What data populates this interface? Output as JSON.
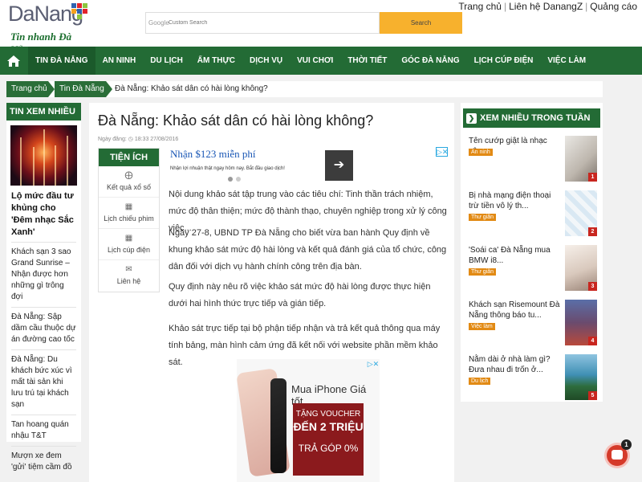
{
  "header": {
    "logo_text": "DaNang",
    "tagline": "Tin nhanh Đà Nẵng",
    "search_brand": "Google",
    "search_placeholder": "Custom Search",
    "search_button": "Search",
    "top_links": [
      "Trang chủ",
      "Liên hệ DanangZ",
      "Quảng cáo"
    ]
  },
  "nav": {
    "items": [
      "Tin Đà Nẵng",
      "An ninh",
      "Du lịch",
      "Ẩm thực",
      "Dịch vụ",
      "Vui chơi",
      "Thời tiết",
      "Góc Đà Nẵng",
      "Lịch cúp điện",
      "Việc làm"
    ]
  },
  "breadcrumb": {
    "home": "Trang chủ",
    "category": "Tin Đà Nẵng",
    "current": "Đà Nẵng: Khảo sát dân có hài lòng không?"
  },
  "left_sidebar": {
    "heading": "TIN XEM NHIỀU",
    "lead": "Lộ mức đầu tư khủng cho 'Đêm nhạc Sắc Xanh'",
    "items": [
      "Khách sạn 3 sao Grand Sunrise – Nhận được hơn những gì trông đợi",
      "Đà Nẵng: Sập dầm cầu thuộc dự án đường cao tốc",
      "Đà Nẵng: Du khách bức xúc vì mất tài sản khi lưu trú tại khách sạn",
      "Tan hoang quán nhậu T&T",
      "Mượn xe đem 'gửi' tiệm cầm đồ"
    ]
  },
  "article": {
    "title": "Đà Nẵng: Khảo sát dân có hài lòng không?",
    "date_label": "Ngày đăng:",
    "date_value": "18:33 27/08/2016",
    "paragraphs": [
      "Nội dung khảo sát tập trung vào các tiêu chí: Tinh thần trách nhiệm, mức độ thân thiện; mức độ thành thạo, chuyên nghiệp trong xử lý công việc...",
      "Ngày 27-8, UBND TP Đà Nẵng cho biết vừa ban hành Quy định về khung khảo sát mức độ hài lòng và kết quả đánh giá của tổ chức, công dân đối với dịch vụ hành chính công trên địa bàn.",
      "Quy định này nêu rõ việc khảo sát mức độ hài lòng được thực hiện dưới hai hình thức trực tiếp và gián tiếp.",
      "Khảo sát trực tiếp tại bộ phận tiếp nhận và trả kết quả thông qua máy tính bảng, màn hình cảm ứng đã kết nối với website phần mềm khảo sát."
    ]
  },
  "tienich": {
    "heading": "TIỆN ÍCH",
    "items": [
      {
        "label": "Kết quả xổ số",
        "icon": "lottery-icon"
      },
      {
        "label": "Lịch chiếu phim",
        "icon": "calendar-icon"
      },
      {
        "label": "Lịch cúp điện",
        "icon": "calendar-icon"
      },
      {
        "label": "Liên hệ",
        "icon": "mail-icon"
      }
    ]
  },
  "ads": {
    "ad1_headline": "Nhận $123 miễn phí",
    "ad1_sub": "Nhận lợi nhuận thật ngay hôm nay. Bắt đầu giao dịch!",
    "ad1_arrow": "➔",
    "ad2_headline": "Mua iPhone Giá tốt",
    "ad2_line1": "TẶNG VOUCHER",
    "ad2_line2": "ĐẾN 2 TRIỆU",
    "ad2_line3": "TRẢ GÓP 0%"
  },
  "right_sidebar": {
    "heading": "XEM NHIỀU TRONG TUẦN",
    "items": [
      {
        "title": "Tên cướp giật là nhạc công",
        "tag": "An ninh",
        "rank": "1"
      },
      {
        "title": "Bị nhà mạng điện thoại trừ tiền vô lý th...",
        "tag": "Thư giãn",
        "rank": "2"
      },
      {
        "title": "'Soái ca' Đà Nẵng mua BMW i8...",
        "tag": "Thư giãn",
        "rank": "3"
      },
      {
        "title": "Khách sạn Risemount Đà Nẵng thông báo tu...",
        "tag": "Việc làm",
        "rank": "4"
      },
      {
        "title": "Nằm dài ở nhà làm gì? Đưa nhau đi trốn ở...",
        "tag": "Du lịch",
        "rank": "5"
      }
    ]
  },
  "chat": {
    "badge": "1"
  },
  "colors": {
    "brand_green": "#236b35",
    "accent_orange": "#f7b12d",
    "rank_red": "#c8261f"
  }
}
